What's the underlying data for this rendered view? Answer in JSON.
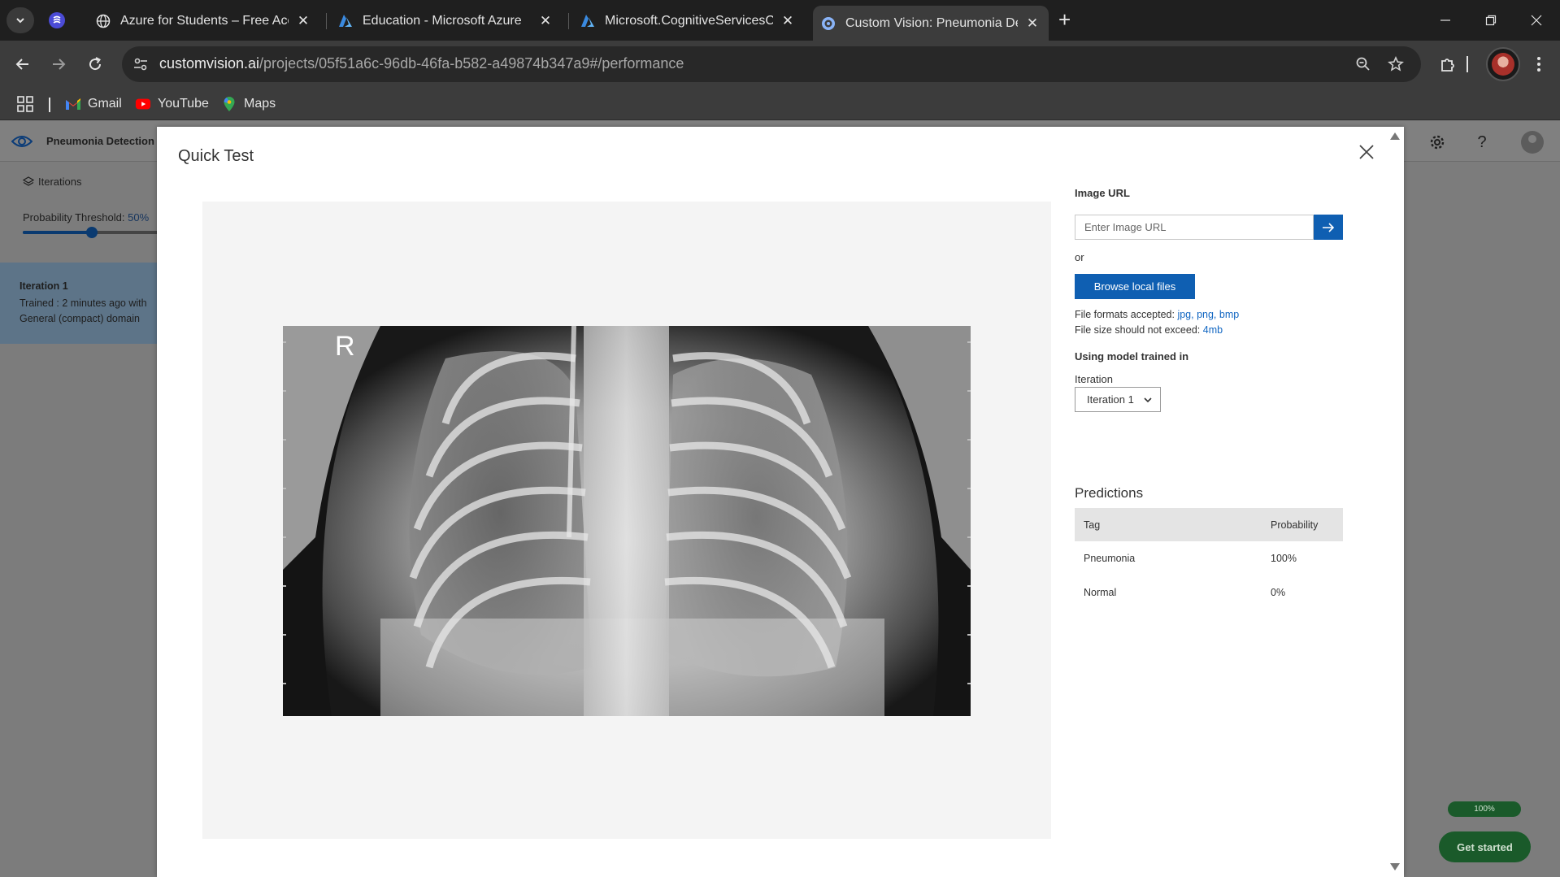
{
  "browser": {
    "tabs": [
      {
        "title": "Azure for Students – Free Account",
        "icon": "globe-icon"
      },
      {
        "title": "Education - Microsoft Azure",
        "icon": "azure-icon"
      },
      {
        "title": "Microsoft.CognitiveServicesCustomVision",
        "icon": "azure-icon"
      },
      {
        "title": "Custom Vision: Pneumonia Detection",
        "icon": "custom-vision-icon",
        "active": true
      }
    ],
    "url_host": "customvision.ai",
    "url_path": "/projects/05f51a6c-96db-46fa-b582-a49874b347a9#/performance",
    "bookmarks": [
      {
        "label": "Gmail",
        "icon": "gmail-icon"
      },
      {
        "label": "YouTube",
        "icon": "youtube-icon"
      },
      {
        "label": "Maps",
        "icon": "maps-icon"
      }
    ]
  },
  "app": {
    "project_name": "Pneumonia Detection",
    "sidebar": {
      "iterations_label": "Iterations",
      "threshold_label": "Probability Threshold:",
      "threshold_value": "50%",
      "threshold_fraction": 0.5,
      "iteration": {
        "name": "Iteration 1",
        "trained": "Trained : 2 minutes ago with",
        "domain": "General (compact) domain"
      }
    },
    "progress_pill": "100%",
    "get_started_label": "Get started"
  },
  "modal": {
    "title": "Quick Test",
    "image_url_label": "Image URL",
    "image_url_placeholder": "Enter Image URL",
    "or_label": "or",
    "browse_label": "Browse local files",
    "formats_label": "File formats accepted:",
    "formats": "jpg, png, bmp",
    "size_label": "File size should not exceed:",
    "size_limit": "4mb",
    "model_label": "Using model trained in",
    "iteration_label": "Iteration",
    "iteration_value": "Iteration 1",
    "xray_marker": "R",
    "predictions": {
      "title": "Predictions",
      "columns": [
        "Tag",
        "Probability"
      ],
      "rows": [
        {
          "tag": "Pneumonia",
          "probability": "100%"
        },
        {
          "tag": "Normal",
          "probability": "0%"
        }
      ]
    }
  },
  "colors": {
    "accent": "#0f5fb2",
    "link": "#1166c2",
    "chrome_dark": "#1f1f1f",
    "chrome": "#3c3c3c"
  }
}
